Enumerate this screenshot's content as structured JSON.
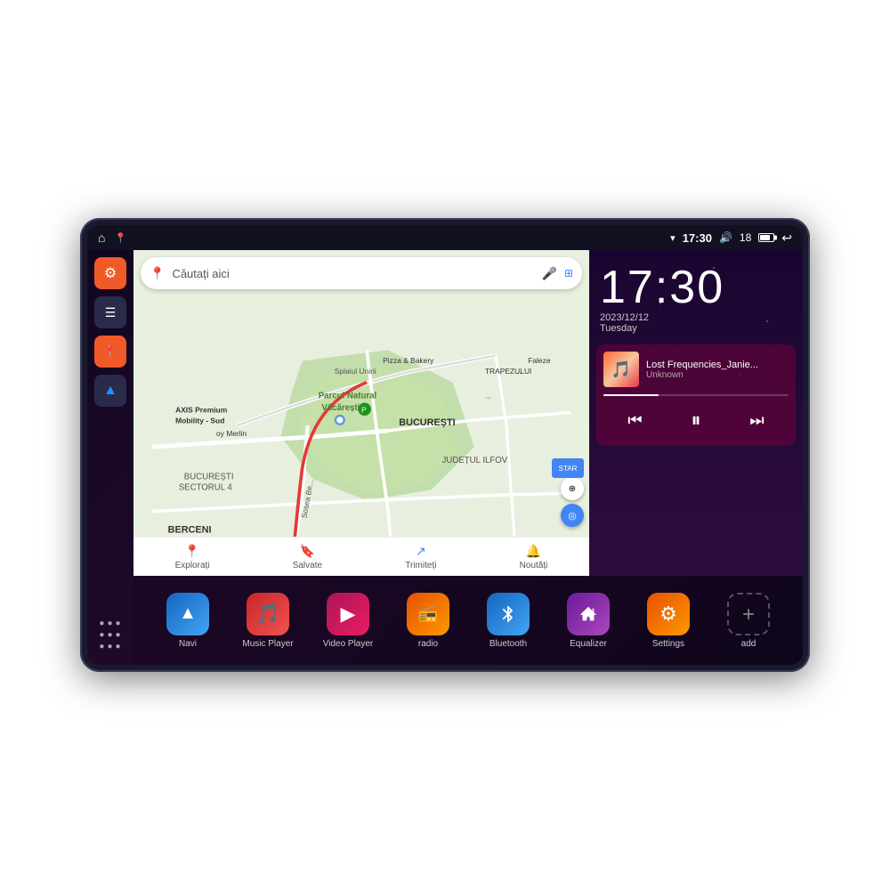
{
  "device": {
    "status_bar": {
      "home_icon": "⌂",
      "map_icon": "📍",
      "wifi_icon": "▾",
      "time": "17:30",
      "volume_icon": "🔊",
      "battery_level": "18",
      "back_icon": "↩"
    },
    "sidebar": {
      "buttons": [
        {
          "id": "settings",
          "icon": "⚙",
          "color": "orange"
        },
        {
          "id": "files",
          "icon": "☰",
          "color": "dark"
        },
        {
          "id": "maps",
          "icon": "📍",
          "color": "orange"
        },
        {
          "id": "nav",
          "icon": "▲",
          "color": "dark"
        },
        {
          "id": "apps",
          "icon": "⋮⋮⋮",
          "color": "apps"
        }
      ]
    },
    "map": {
      "search_placeholder": "Căutați aici",
      "location_areas": [
        "AXIS Premium Mobility - Sud",
        "Pizza & Bakery",
        "TRAPEZULUI",
        "Parcul Natural Văcărești",
        "BUCUREȘTI",
        "BUCUREȘTI SECTORUL 4",
        "JUDEȚUL ILFOV",
        "BERCENI",
        "oy Merlin"
      ],
      "bottom_items": [
        {
          "icon": "📍",
          "label": "Explorați"
        },
        {
          "icon": "🔖",
          "label": "Salvate"
        },
        {
          "icon": "↗",
          "label": "Trimiteți"
        },
        {
          "icon": "🔔",
          "label": "Noutăți"
        }
      ]
    },
    "music_player": {
      "time": "17:30",
      "date": "2023/12/12",
      "day": "Tuesday",
      "track_name": "Lost Frequencies_Janie...",
      "artist": "Unknown",
      "progress": 30
    },
    "apps": [
      {
        "id": "navi",
        "label": "Navi",
        "icon": "▲",
        "style": "blue-nav"
      },
      {
        "id": "music",
        "label": "Music Player",
        "icon": "♪",
        "style": "red-music"
      },
      {
        "id": "video",
        "label": "Video Player",
        "icon": "▶",
        "style": "red-video"
      },
      {
        "id": "radio",
        "label": "radio",
        "icon": "📶",
        "style": "orange-radio"
      },
      {
        "id": "bluetooth",
        "label": "Bluetooth",
        "icon": "₿",
        "style": "blue-bt"
      },
      {
        "id": "equalizer",
        "label": "Equalizer",
        "icon": "≡",
        "style": "purple-eq"
      },
      {
        "id": "settings",
        "label": "Settings",
        "icon": "⚙",
        "style": "orange-settings"
      },
      {
        "id": "add",
        "label": "add",
        "icon": "+",
        "style": "gray-add"
      }
    ]
  }
}
